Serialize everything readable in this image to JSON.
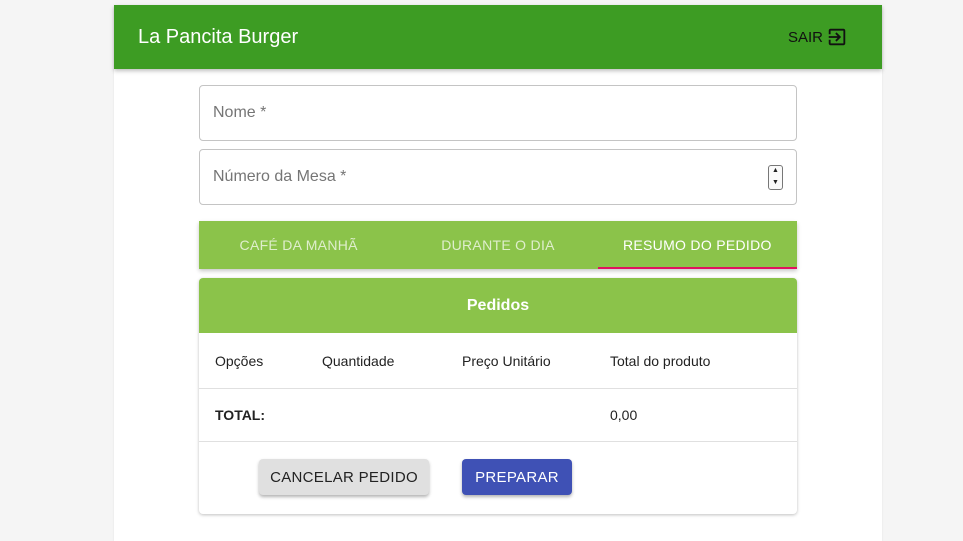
{
  "header": {
    "title": "La Pancita Burger",
    "logout_label": "SAIR",
    "logout_icon": "exit-to-app-icon",
    "color": "#3d9c23"
  },
  "form": {
    "name_placeholder": "Nome *",
    "table_placeholder": "Número da Mesa *"
  },
  "tabs": [
    {
      "label": "CAFÉ DA MANHÃ",
      "active": false
    },
    {
      "label": "DURANTE O DIA",
      "active": false
    },
    {
      "label": "RESUMO DO PEDIDO",
      "active": true
    }
  ],
  "order": {
    "title": "Pedidos",
    "columns": [
      "Opções",
      "Quantidade",
      "Preço Unitário",
      "Total do produto"
    ],
    "total_label": "TOTAL:",
    "total_value": "0,00"
  },
  "actions": {
    "cancel_label": "CANCELAR PEDIDO",
    "prepare_label": "PREPARAR"
  },
  "colors": {
    "tab_bar": "#8bc34a",
    "active_indicator": "#e0115f",
    "primary_button": "#3f51b5"
  }
}
